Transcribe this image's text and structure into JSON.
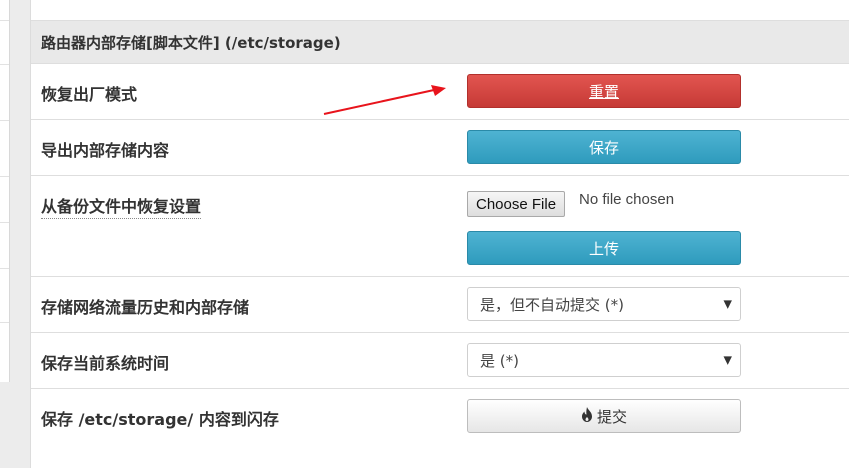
{
  "section": {
    "title": "路由器内部存储[脚本文件] (/etc/storage)"
  },
  "rows": {
    "reset": {
      "label": "恢复出厂模式",
      "button": "重置"
    },
    "export": {
      "label": "导出内部存储内容",
      "button": "保存"
    },
    "restore": {
      "label": "从备份文件中恢复设置",
      "file_button": "Choose File",
      "file_status": "No file chosen",
      "upload_button": "上传"
    },
    "traffic": {
      "label": "存储网络流量历史和内部存储",
      "selected": "是，但不自动提交 (*)"
    },
    "time": {
      "label": "保存当前系统时间",
      "selected": "是 (*)"
    },
    "commit": {
      "label": "保存 /etc/storage/ 内容到闪存",
      "button": "提交",
      "icon": "fire-icon"
    }
  },
  "colors": {
    "danger": "#d9534f",
    "info": "#3ea8c9",
    "annotation_arrow": "#e8141c"
  }
}
